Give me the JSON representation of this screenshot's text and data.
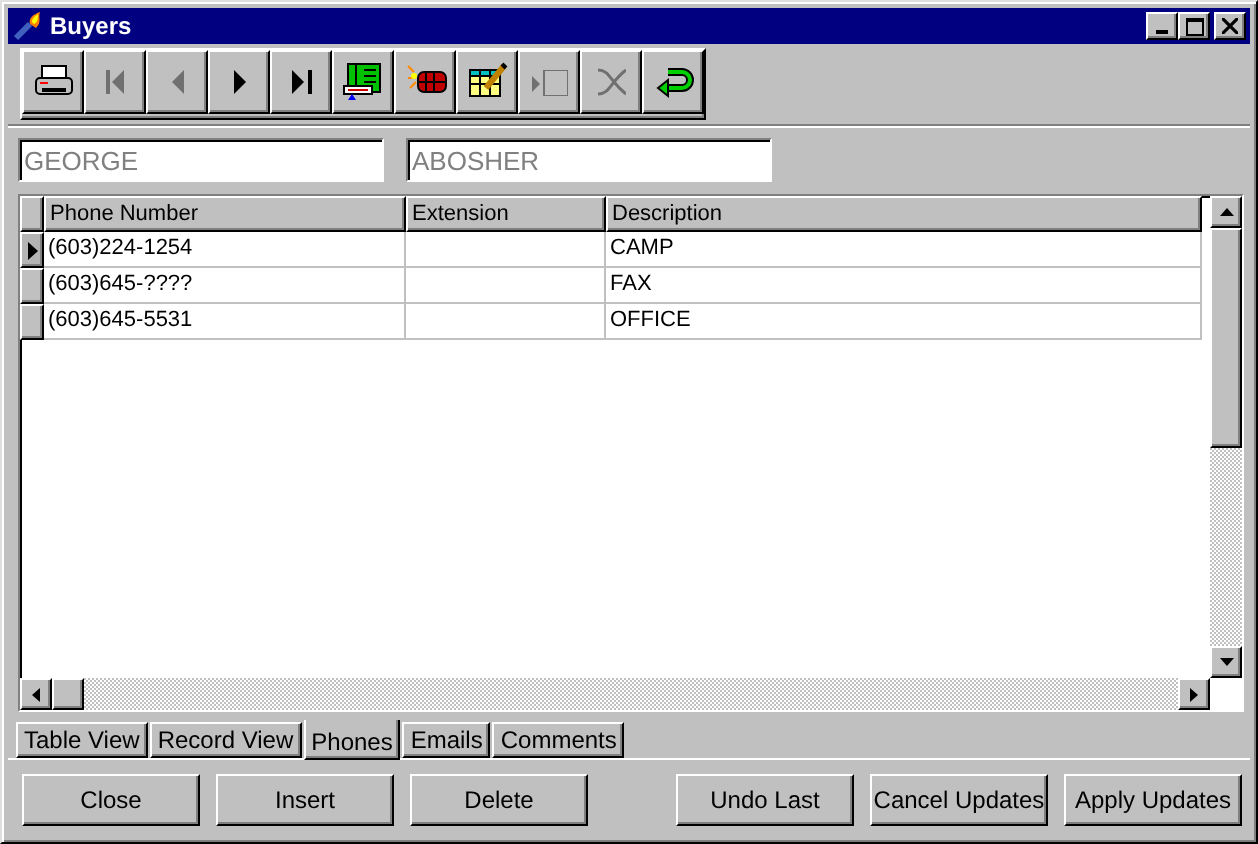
{
  "window": {
    "title": "Buyers"
  },
  "toolbar": [
    {
      "kind": "printer",
      "disabled": false
    },
    {
      "kind": "first",
      "disabled": true
    },
    {
      "kind": "prior",
      "disabled": true
    },
    {
      "kind": "next",
      "disabled": false
    },
    {
      "kind": "last",
      "disabled": false
    },
    {
      "kind": "grid",
      "disabled": false
    },
    {
      "kind": "dynamite",
      "disabled": false
    },
    {
      "kind": "edit",
      "disabled": false
    },
    {
      "kind": "post",
      "disabled": true
    },
    {
      "kind": "cancel",
      "disabled": true
    },
    {
      "kind": "undo",
      "disabled": false
    }
  ],
  "name_fields": [
    {
      "value": "GEORGE"
    },
    {
      "value": "ABOSHER"
    }
  ],
  "table": {
    "columns": [
      "Phone Number",
      "Extension",
      "Description"
    ],
    "rows": [
      {
        "cells": [
          "(603)224-1254",
          "",
          "CAMP"
        ],
        "selected": true
      },
      {
        "cells": [
          "(603)645-????",
          "",
          "FAX"
        ],
        "selected": false
      },
      {
        "cells": [
          "(603)645-5531",
          "",
          "OFFICE"
        ],
        "selected": false
      }
    ]
  },
  "tabs": [
    {
      "label": "Table View",
      "selected": false
    },
    {
      "label": "Record View",
      "selected": false
    },
    {
      "label": "Phones",
      "selected": true
    },
    {
      "label": "Emails",
      "selected": false
    },
    {
      "label": "Comments",
      "selected": false
    }
  ],
  "buttons": [
    "Close",
    "Insert",
    "Delete",
    "Undo Last",
    "Cancel Updates",
    "Apply Updates"
  ]
}
